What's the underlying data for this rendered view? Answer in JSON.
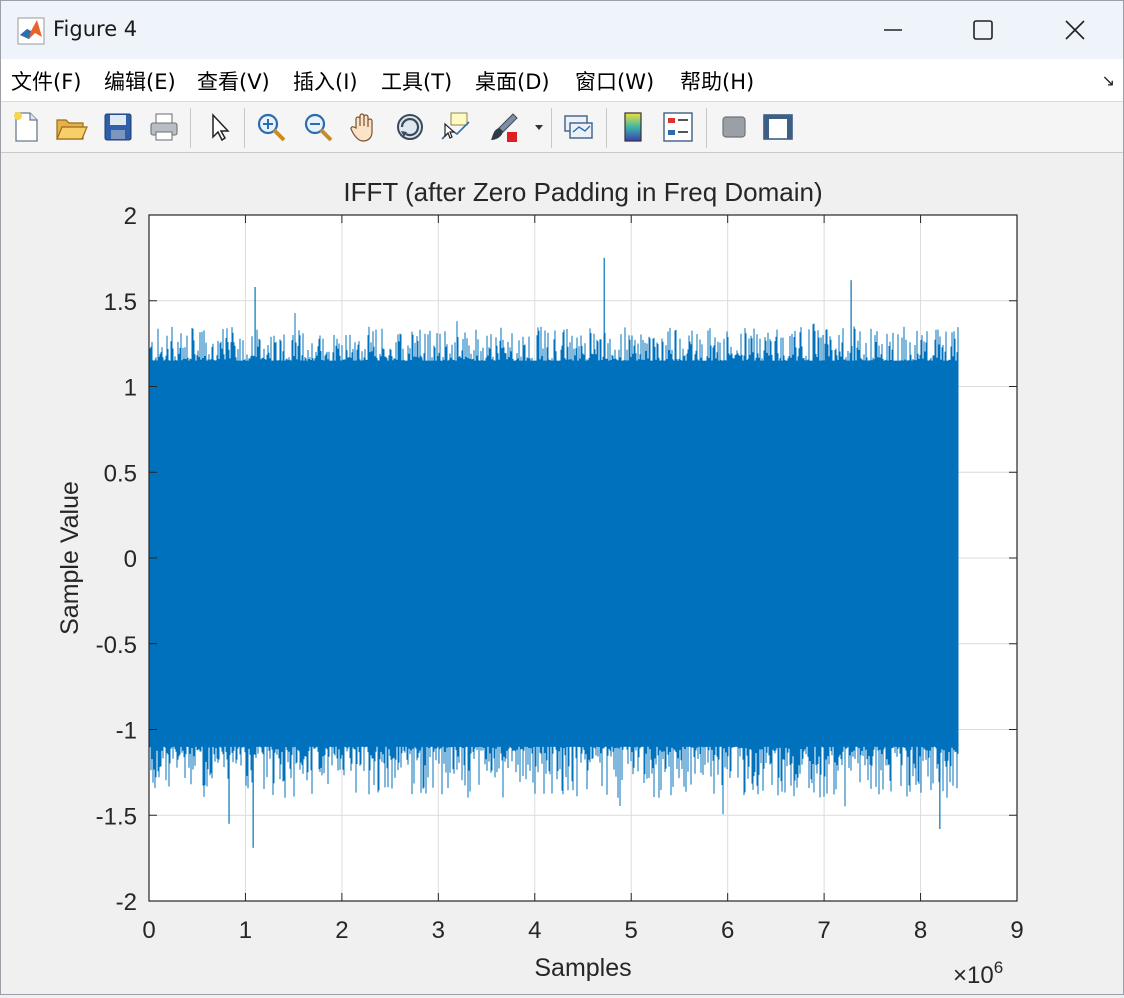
{
  "window": {
    "title": "Figure 4",
    "minimize_symbol": "—",
    "maximize_symbol": "☐",
    "close_symbol": "✕"
  },
  "menu": {
    "items": [
      {
        "label": "文件(F)",
        "key": "F"
      },
      {
        "label": "编辑(E)",
        "key": "E"
      },
      {
        "label": "查看(V)",
        "key": "V"
      },
      {
        "label": "插入(I)",
        "key": "I"
      },
      {
        "label": "工具(T)",
        "key": "T"
      },
      {
        "label": "桌面(D)",
        "key": "D"
      },
      {
        "label": "窗口(W)",
        "key": "W"
      },
      {
        "label": "帮助(H)",
        "key": "H"
      }
    ],
    "overflow_symbol": "↘"
  },
  "toolbar": {
    "buttons": [
      {
        "icon": "new-figure-icon"
      },
      {
        "icon": "open-file-icon"
      },
      {
        "icon": "save-icon"
      },
      {
        "icon": "print-icon"
      },
      {
        "icon": "select-arrow-icon"
      },
      {
        "icon": "zoom-in-icon"
      },
      {
        "icon": "zoom-out-icon"
      },
      {
        "icon": "pan-hand-icon"
      },
      {
        "icon": "rotate-3d-icon"
      },
      {
        "icon": "data-cursor-icon"
      },
      {
        "icon": "brush-icon"
      },
      {
        "icon": "link-plot-icon"
      },
      {
        "icon": "colorbar-icon"
      },
      {
        "icon": "legend-icon"
      },
      {
        "icon": "hide-plot-tools-icon"
      },
      {
        "icon": "show-plot-tools-icon"
      }
    ]
  },
  "chart_data": {
    "type": "line",
    "title": "IFFT (after Zero Padding in Freq Domain)",
    "xlabel": "Samples",
    "ylabel": "Sample Value",
    "xlim": [
      0,
      9
    ],
    "ylim": [
      -2,
      2
    ],
    "x_multiplier": "×10",
    "x_multiplier_exponent": "6",
    "xticks": [
      "0",
      "1",
      "2",
      "3",
      "4",
      "5",
      "6",
      "7",
      "8",
      "9"
    ],
    "yticks": [
      "-2",
      "-1.5",
      "-1",
      "-0.5",
      "0",
      "0.5",
      "1",
      "1.5",
      "2"
    ],
    "grid": true,
    "color": "#0072BD",
    "series": [
      {
        "x_start": 0,
        "x_end": 8.39,
        "dense_band": [
          -1.1,
          1.15
        ],
        "typical_max": 1.3,
        "typical_min": -1.35,
        "peaks": [
          {
            "x": 1.1,
            "y": 1.58
          },
          {
            "x": 4.72,
            "y": 1.75
          },
          {
            "x": 7.28,
            "y": 1.62
          },
          {
            "x": 1.08,
            "y": -1.69
          },
          {
            "x": 8.2,
            "y": -1.58
          },
          {
            "x": 0.83,
            "y": -1.55
          }
        ]
      }
    ]
  }
}
